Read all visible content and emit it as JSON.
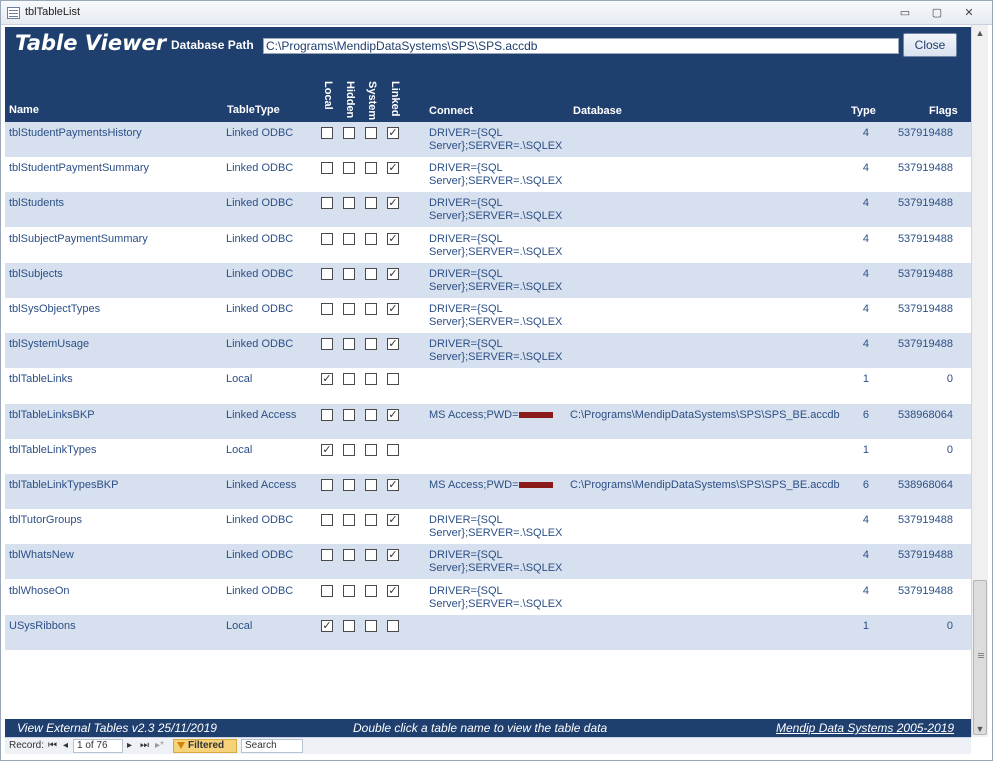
{
  "window": {
    "title": "tblTableList",
    "min": "▭",
    "max": "▢",
    "close": "✕"
  },
  "header": {
    "app_title": "Table Viewer",
    "db_label": "Database Path",
    "db_path": "C:\\Programs\\MendipDataSystems\\SPS\\SPS.accdb",
    "close_label": "Close"
  },
  "columns": {
    "name": "Name",
    "tabletype": "TableType",
    "local": "Local",
    "hidden": "Hidden",
    "system": "System",
    "linked": "Linked",
    "connect": "Connect",
    "database": "Database",
    "type": "Type",
    "flags": "Flags"
  },
  "rows": [
    {
      "name": "tblStudentPaymentsHistory",
      "tabletype": "Linked ODBC",
      "local": false,
      "hidden": false,
      "system": false,
      "linked": true,
      "connect": "DRIVER={SQL Server};SERVER=.\\SQLEX",
      "database": "",
      "type": "4",
      "flags": "537919488"
    },
    {
      "name": "tblStudentPaymentSummary",
      "tabletype": "Linked ODBC",
      "local": false,
      "hidden": false,
      "system": false,
      "linked": true,
      "connect": "DRIVER={SQL Server};SERVER=.\\SQLEX",
      "database": "",
      "type": "4",
      "flags": "537919488"
    },
    {
      "name": "tblStudents",
      "tabletype": "Linked ODBC",
      "local": false,
      "hidden": false,
      "system": false,
      "linked": true,
      "connect": "DRIVER={SQL Server};SERVER=.\\SQLEX",
      "database": "",
      "type": "4",
      "flags": "537919488"
    },
    {
      "name": "tblSubjectPaymentSummary",
      "tabletype": "Linked ODBC",
      "local": false,
      "hidden": false,
      "system": false,
      "linked": true,
      "connect": "DRIVER={SQL Server};SERVER=.\\SQLEX",
      "database": "",
      "type": "4",
      "flags": "537919488"
    },
    {
      "name": "tblSubjects",
      "tabletype": "Linked ODBC",
      "local": false,
      "hidden": false,
      "system": false,
      "linked": true,
      "connect": "DRIVER={SQL Server};SERVER=.\\SQLEX",
      "database": "",
      "type": "4",
      "flags": "537919488"
    },
    {
      "name": "tblSysObjectTypes",
      "tabletype": "Linked ODBC",
      "local": false,
      "hidden": false,
      "system": false,
      "linked": true,
      "connect": "DRIVER={SQL Server};SERVER=.\\SQLEX",
      "database": "",
      "type": "4",
      "flags": "537919488"
    },
    {
      "name": "tblSystemUsage",
      "tabletype": "Linked ODBC",
      "local": false,
      "hidden": false,
      "system": false,
      "linked": true,
      "connect": "DRIVER={SQL Server};SERVER=.\\SQLEX",
      "database": "",
      "type": "4",
      "flags": "537919488"
    },
    {
      "name": "tblTableLinks",
      "tabletype": "Local",
      "local": true,
      "hidden": false,
      "system": false,
      "linked": false,
      "connect": "",
      "database": "",
      "type": "1",
      "flags": "0"
    },
    {
      "name": "tblTableLinksBKP",
      "tabletype": "Linked Access",
      "local": false,
      "hidden": false,
      "system": false,
      "linked": true,
      "connect": "MS Access;PWD=",
      "redacted": true,
      "database": "C:\\Programs\\MendipDataSystems\\SPS\\SPS_BE.accdb",
      "type": "6",
      "flags": "538968064"
    },
    {
      "name": "tblTableLinkTypes",
      "tabletype": "Local",
      "local": true,
      "hidden": false,
      "system": false,
      "linked": false,
      "connect": "",
      "database": "",
      "type": "1",
      "flags": "0"
    },
    {
      "name": "tblTableLinkTypesBKP",
      "tabletype": "Linked Access",
      "local": false,
      "hidden": false,
      "system": false,
      "linked": true,
      "connect": "MS Access;PWD=",
      "redacted": true,
      "database": "C:\\Programs\\MendipDataSystems\\SPS\\SPS_BE.accdb",
      "type": "6",
      "flags": "538968064"
    },
    {
      "name": "tblTutorGroups",
      "tabletype": "Linked ODBC",
      "local": false,
      "hidden": false,
      "system": false,
      "linked": true,
      "connect": "DRIVER={SQL Server};SERVER=.\\SQLEX",
      "database": "",
      "type": "4",
      "flags": "537919488"
    },
    {
      "name": "tblWhatsNew",
      "tabletype": "Linked ODBC",
      "local": false,
      "hidden": false,
      "system": false,
      "linked": true,
      "connect": "DRIVER={SQL Server};SERVER=.\\SQLEX",
      "database": "",
      "type": "4",
      "flags": "537919488"
    },
    {
      "name": "tblWhoseOn",
      "tabletype": "Linked ODBC",
      "local": false,
      "hidden": false,
      "system": false,
      "linked": true,
      "connect": "DRIVER={SQL Server};SERVER=.\\SQLEX",
      "database": "",
      "type": "4",
      "flags": "537919488"
    },
    {
      "name": "USysRibbons",
      "tabletype": "Local",
      "local": true,
      "hidden": false,
      "system": false,
      "linked": false,
      "connect": "",
      "database": "",
      "type": "1",
      "flags": "0"
    }
  ],
  "footer": {
    "version": "View External Tables  v2.3  25/11/2019",
    "hint": "Double click a table name to view the table data",
    "link": "Mendip Data Systems 2005-2019"
  },
  "navbar": {
    "record_label": "Record:",
    "first": "⏮",
    "prev": "◂",
    "next": "▸",
    "last": "⏭",
    "new": "▸*",
    "record_value": "1 of 76",
    "filtered": "Filtered",
    "search": "Search"
  },
  "colors": {
    "header_bg": "#1f3f6f",
    "alt_row": "#d6e0ee",
    "text": "#2c4f86",
    "redaction": "#8b1a1a"
  }
}
